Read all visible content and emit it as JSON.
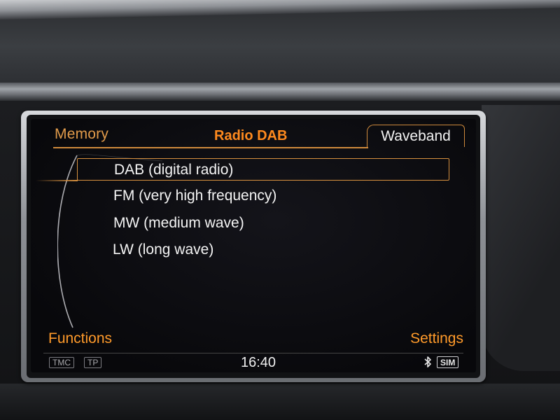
{
  "header": {
    "left_tab": "Memory",
    "title": "Radio DAB",
    "right_tab": "Waveband"
  },
  "waveband_list": {
    "selected_index": 0,
    "items": [
      {
        "label": "DAB (digital radio)"
      },
      {
        "label": "FM (very high frequency)"
      },
      {
        "label": "MW (medium wave)"
      },
      {
        "label": "LW (long wave)"
      }
    ]
  },
  "footer": {
    "left_label": "Functions",
    "right_label": "Settings"
  },
  "status_bar": {
    "badges": [
      "TMC",
      "TP"
    ],
    "time": "16:40",
    "bluetooth_icon": "bluetooth-icon",
    "sim_label": "SIM"
  },
  "colors": {
    "accent_orange": "#ff8a1e",
    "tab_orange": "#e09a4a",
    "text_white": "#f4f4f4",
    "screen_bg": "#08080b"
  }
}
